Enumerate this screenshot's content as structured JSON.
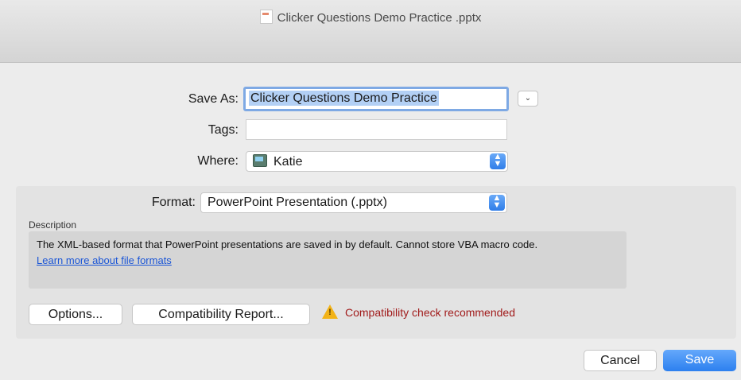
{
  "window": {
    "title": "Clicker Questions Demo Practice .pptx",
    "icon": "pptx-document-icon"
  },
  "save_as": {
    "label": "Save As:",
    "value": "Clicker Questions Demo Practice",
    "expand_icon": "chevron-down-icon"
  },
  "tags": {
    "label": "Tags:",
    "value": ""
  },
  "where": {
    "label": "Where:",
    "value": "Katie",
    "icon": "hard-drive-icon"
  },
  "format": {
    "label": "Format:",
    "value": "PowerPoint Presentation (.pptx)"
  },
  "description": {
    "label": "Description",
    "text": "The XML-based format that PowerPoint presentations are saved in by default. Cannot store VBA macro code.",
    "link": "Learn more about file formats"
  },
  "buttons": {
    "options": "Options...",
    "compatibility": "Compatibility Report...",
    "cancel": "Cancel",
    "save": "Save"
  },
  "warning": {
    "text": "Compatibility check recommended",
    "icon": "warning-triangle-icon",
    "color": "#a11b1b"
  },
  "colors": {
    "accent": "#2d80ef",
    "selection": "#b3d0f5"
  }
}
